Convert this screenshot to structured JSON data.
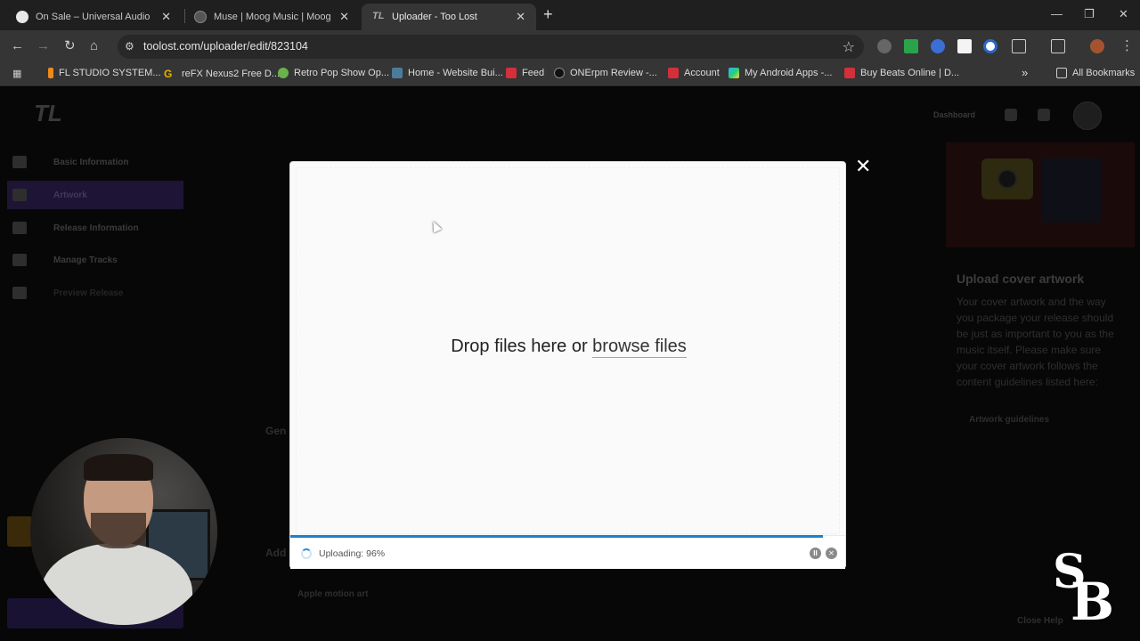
{
  "browser": {
    "tabs": [
      {
        "title": "On Sale – Universal Audio",
        "active": false
      },
      {
        "title": "Muse | Moog Music | Moog Mu",
        "active": false
      },
      {
        "title": "Uploader - Too Lost",
        "active": true
      }
    ],
    "url": "toolost.com/uploader/edit/823104",
    "bookmarks": [
      "FL STUDIO SYSTEM...",
      "reFX Nexus2 Free D...",
      "Retro Pop Show Op...",
      "Home - Website Bui...",
      "Feed",
      "ONErpm Review -...",
      "Account",
      "My Android Apps -...",
      "Buy Beats Online | D..."
    ],
    "all_bookmarks": "All Bookmarks"
  },
  "page": {
    "sidebar": [
      "Basic Information",
      "Artwork",
      "Release Information",
      "Manage Tracks",
      "Preview Release"
    ],
    "header_dashboard": "Dashboard",
    "aside": {
      "title": "Upload cover artwork",
      "body": "Your cover artwork and the way you package your release should be just as important to you as the music itself. Please make sure your cover artwork follows the content guidelines listed here:",
      "link": "Artwork guidelines"
    },
    "section_gen": "Gen",
    "section_add": "Add",
    "apple_motion": "Apple motion art",
    "close_help": "Close Help"
  },
  "modal": {
    "drop_prefix": "Drop files here or ",
    "browse_label": "browse files",
    "status": "Uploading: 96%",
    "progress": 0.96,
    "close_symbol": "✕"
  }
}
